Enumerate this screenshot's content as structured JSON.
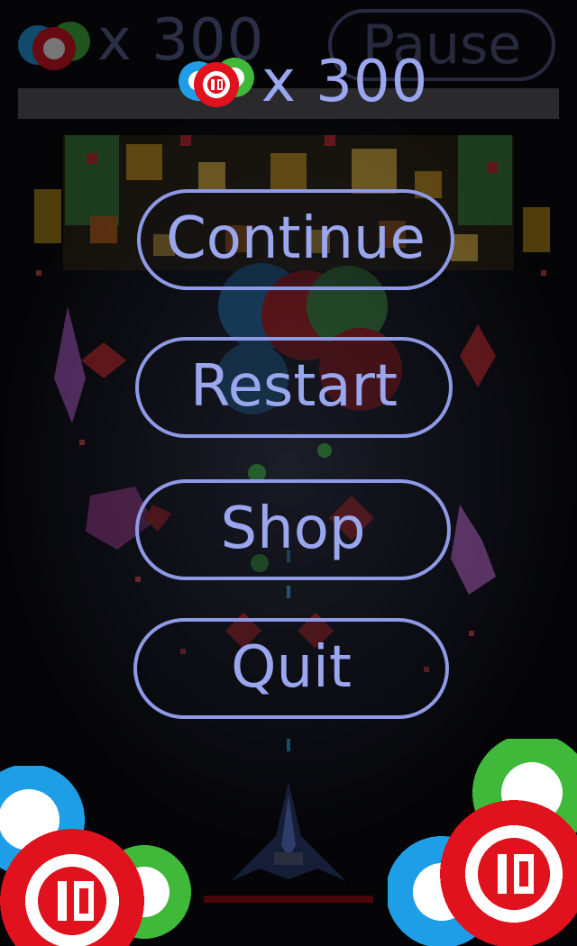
{
  "hud": {
    "coin_count": "x 300",
    "pause_label": "Pause",
    "coin_icon": "poker-chips-icon"
  },
  "overlay": {
    "coin_count": "x 300",
    "coin_icon": "poker-chips-icon"
  },
  "menu": {
    "continue_label": "Continue",
    "restart_label": "Restart",
    "shop_label": "Shop",
    "quit_label": "Quit"
  },
  "player": {
    "ship_icon": "spaceship-icon",
    "health_bar_color": "#4a0606"
  },
  "colors": {
    "accent": "#9aa6ee",
    "button_border": "#8e9ae6",
    "chip_red": "#e0121e",
    "chip_blue": "#1e9ee6",
    "chip_green": "#40b83a"
  }
}
